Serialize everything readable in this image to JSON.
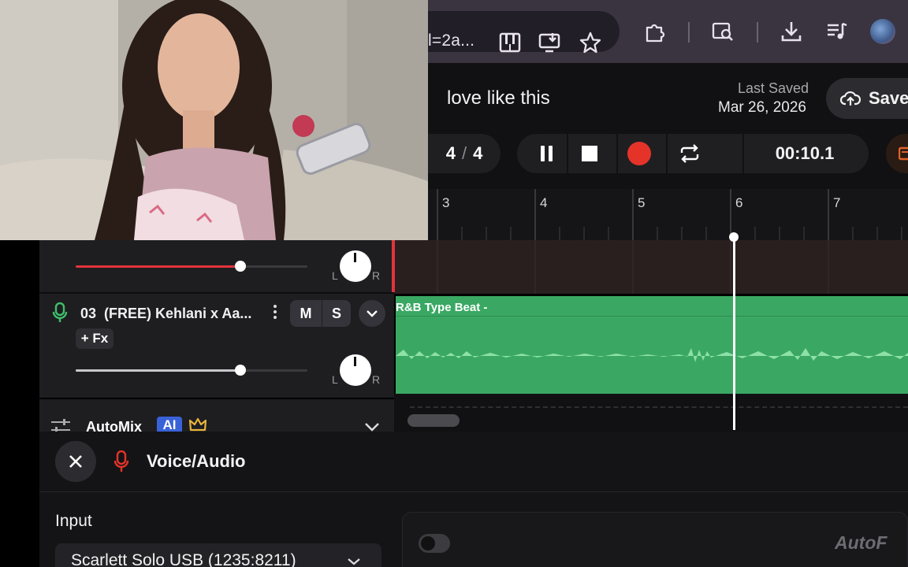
{
  "browser": {
    "url_fragment": "l=2a...",
    "icons": [
      "piano-icon",
      "install-app-icon",
      "star-icon",
      "extensions-icon",
      "page-zoom-icon",
      "download-icon",
      "media-queue-icon",
      "profile-avatar-icon"
    ]
  },
  "project": {
    "title": "love like this",
    "last_saved_label": "Last Saved",
    "last_saved_date": "Mar 26, 2026",
    "save_label": "Save"
  },
  "transport": {
    "time_sig_num": "4",
    "time_sig_sep": "/",
    "time_sig_den": "4",
    "time": "00:10.1",
    "record_color": "#e5332a"
  },
  "ruler": {
    "marks": [
      "3",
      "4",
      "5",
      "6",
      "7"
    ]
  },
  "tracks": [
    {
      "volume": 0.71,
      "pan_left": "L",
      "pan_right": "R",
      "accent": "#e0343a"
    },
    {
      "number": "03",
      "name": "(FREE) Kehlani x Aa...",
      "mute_label": "M",
      "solo_label": "S",
      "fx_label": "+ Fx",
      "volume": 0.71,
      "pan_left": "L",
      "pan_right": "R",
      "clip_label": "R&B Type Beat -",
      "accent": "#3aa863"
    }
  ],
  "automix": {
    "label": "AutoMix",
    "badge": "AI"
  },
  "voice_panel": {
    "title": "Voice/Audio",
    "input_label": "Input",
    "input_value": "Scarlett Solo USB (1235:8211)",
    "feature_label": "AutoF"
  }
}
